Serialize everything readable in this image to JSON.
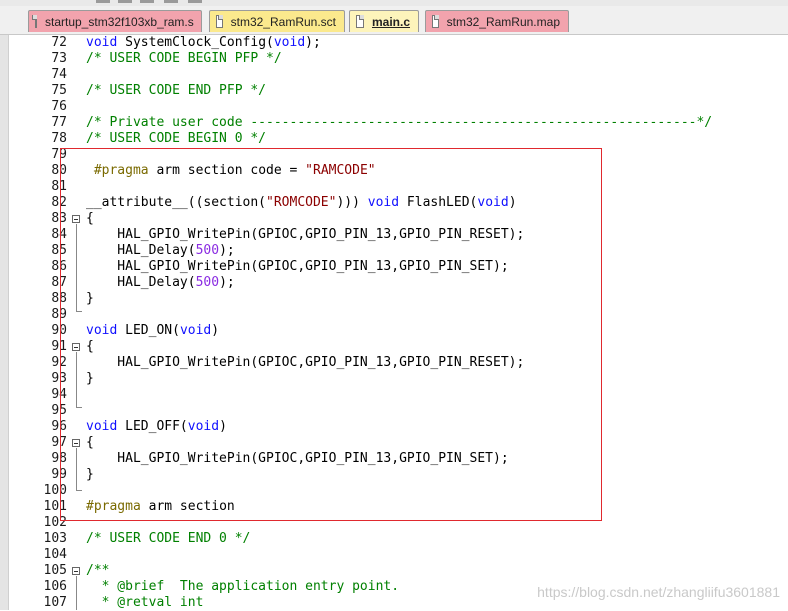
{
  "tabs": [
    {
      "label": "startup_stm32f103xb_ram.s",
      "active": false,
      "color": "#f2a3ad"
    },
    {
      "label": "stm32_RamRun.sct",
      "active": false,
      "color": "#fbe98d"
    },
    {
      "label": "main.c",
      "active": true,
      "color": "#fdf4bb"
    },
    {
      "label": "stm32_RamRun.map",
      "active": false,
      "color": "#f2a3ad"
    }
  ],
  "lines": [
    {
      "n": "72",
      "code": "void SystemClock_Config(void);"
    },
    {
      "n": "73",
      "code": "/* USER CODE BEGIN PFP */"
    },
    {
      "n": "74",
      "code": ""
    },
    {
      "n": "75",
      "code": "/* USER CODE END PFP */"
    },
    {
      "n": "76",
      "code": ""
    },
    {
      "n": "77",
      "code": "/* Private user code ---------------------------------------------------------*/"
    },
    {
      "n": "78",
      "code": "/* USER CODE BEGIN 0 */"
    },
    {
      "n": "79",
      "code": ""
    },
    {
      "n": "80",
      "code": " #pragma arm section code = \"RAMCODE\""
    },
    {
      "n": "81",
      "code": ""
    },
    {
      "n": "82",
      "code": "__attribute__((section(\"ROMCODE\"))) void FlashLED(void)"
    },
    {
      "n": "83",
      "code": "{"
    },
    {
      "n": "84",
      "code": "    HAL_GPIO_WritePin(GPIOC,GPIO_PIN_13,GPIO_PIN_RESET);"
    },
    {
      "n": "85",
      "code": "    HAL_Delay(500);"
    },
    {
      "n": "86",
      "code": "    HAL_GPIO_WritePin(GPIOC,GPIO_PIN_13,GPIO_PIN_SET);"
    },
    {
      "n": "87",
      "code": "    HAL_Delay(500);"
    },
    {
      "n": "88",
      "code": "}"
    },
    {
      "n": "89",
      "code": ""
    },
    {
      "n": "90",
      "code": "void LED_ON(void)"
    },
    {
      "n": "91",
      "code": "{"
    },
    {
      "n": "92",
      "code": "    HAL_GPIO_WritePin(GPIOC,GPIO_PIN_13,GPIO_PIN_RESET);"
    },
    {
      "n": "93",
      "code": "}"
    },
    {
      "n": "94",
      "code": ""
    },
    {
      "n": "95",
      "code": ""
    },
    {
      "n": "96",
      "code": "void LED_OFF(void)"
    },
    {
      "n": "97",
      "code": "{"
    },
    {
      "n": "98",
      "code": "    HAL_GPIO_WritePin(GPIOC,GPIO_PIN_13,GPIO_PIN_SET);"
    },
    {
      "n": "99",
      "code": "}"
    },
    {
      "n": "100",
      "code": ""
    },
    {
      "n": "101",
      "code": "#pragma arm section"
    },
    {
      "n": "102",
      "code": ""
    },
    {
      "n": "103",
      "code": "/* USER CODE END 0 */"
    },
    {
      "n": "104",
      "code": ""
    },
    {
      "n": "105",
      "code": "/**"
    },
    {
      "n": "106",
      "code": "  * @brief  The application entry point."
    },
    {
      "n": "107",
      "code": "  * @retval int"
    }
  ],
  "watermark": "https://blog.csdn.net/zhangliifu3601881",
  "colors": {
    "keyword": "#1010ff",
    "comment": "#008000",
    "string": "#8b0000",
    "number": "#8a2be2",
    "preprocessor": "#7a6a00",
    "selection_box": "#e0292e"
  }
}
